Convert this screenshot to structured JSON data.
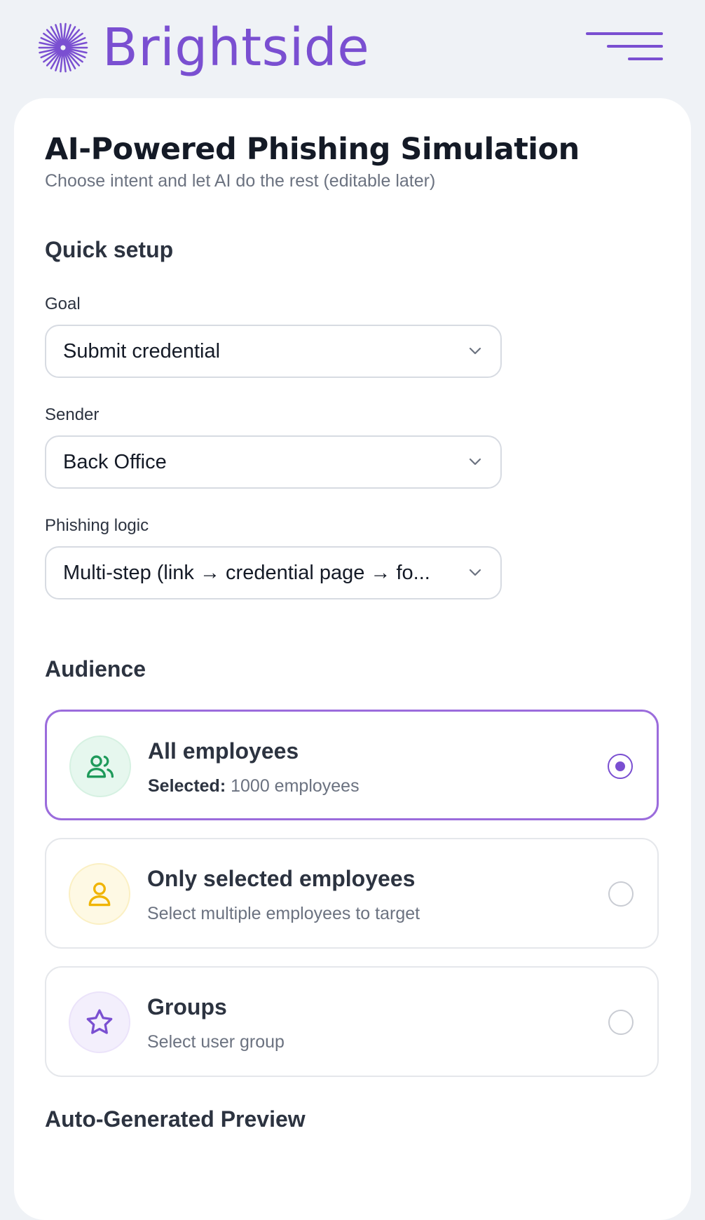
{
  "brand": {
    "name": "Brightside",
    "color": "#7a4fd1"
  },
  "page": {
    "title": "AI-Powered Phishing Simulation",
    "subtitle": "Choose intent and let AI do the rest (editable later)"
  },
  "quick_setup": {
    "heading": "Quick setup",
    "goal": {
      "label": "Goal",
      "value": "Submit credential"
    },
    "sender": {
      "label": "Sender",
      "value": "Back Office"
    },
    "logic": {
      "label": "Phishing logic",
      "value": "Multi-step (link → credential page → fo..."
    }
  },
  "audience": {
    "heading": "Audience",
    "options": [
      {
        "title": "All employees",
        "sub_prefix": "Selected:",
        "sub": "1000 employees",
        "icon": "users-icon",
        "selected": true
      },
      {
        "title": "Only selected employees",
        "sub": "Select multiple employees to target",
        "icon": "user-icon",
        "selected": false
      },
      {
        "title": "Groups",
        "sub": "Select user group",
        "icon": "star-icon",
        "selected": false
      }
    ]
  },
  "preview": {
    "heading": "Auto-Generated Preview"
  }
}
